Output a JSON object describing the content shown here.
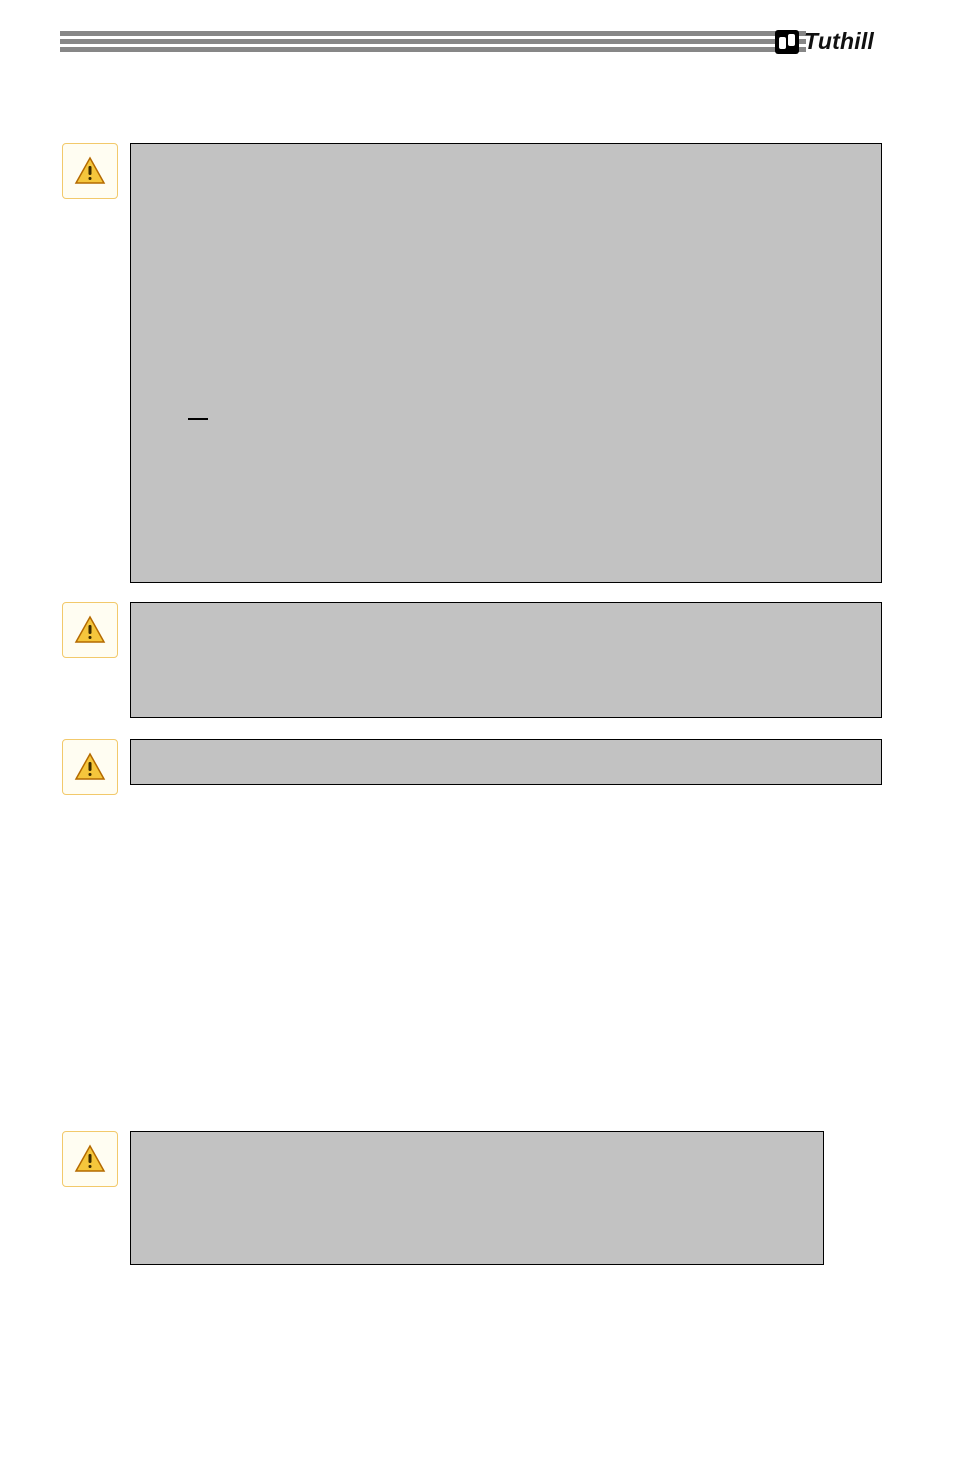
{
  "brand": {
    "name": "Tuthill",
    "logo_alt": "tuthill-logo-mark"
  },
  "header": {
    "bar_count": 3,
    "bar_color": "#878787"
  },
  "warnings": [
    {
      "id": "warning-1",
      "icon": "warning-triangle-icon",
      "box_text": "",
      "has_dash_marker": true
    },
    {
      "id": "warning-2",
      "icon": "warning-triangle-icon",
      "box_text": ""
    },
    {
      "id": "warning-3",
      "icon": "warning-triangle-icon",
      "box_text": ""
    },
    {
      "id": "warning-4",
      "icon": "warning-triangle-icon",
      "box_text": ""
    }
  ]
}
